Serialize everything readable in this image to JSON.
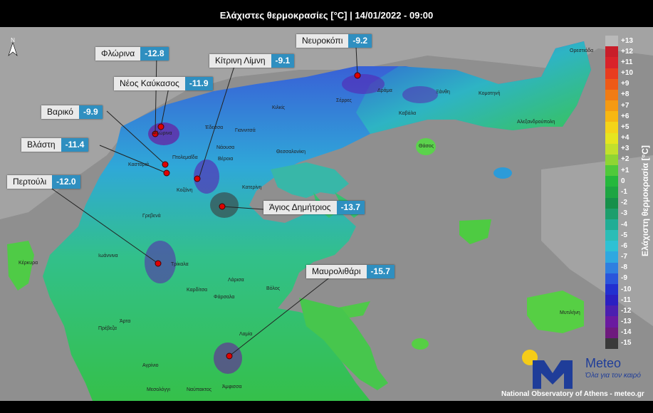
{
  "title": "Ελάχιστες θερμοκρασίες [°C] | 14/01/2022 - 09:00",
  "north_arrow": {
    "icon": "north-arrow-icon",
    "letter": "N"
  },
  "legend": {
    "title": "Ελάχιστη θερμοκρασία [°C]",
    "levels": [
      {
        "value": "+13",
        "color": "#b9b9b9"
      },
      {
        "value": "+12",
        "color": "#c81e2a"
      },
      {
        "value": "+11",
        "color": "#d9232a"
      },
      {
        "value": "+10",
        "color": "#e83c1f"
      },
      {
        "value": "+9",
        "color": "#ee5a17"
      },
      {
        "value": "+8",
        "color": "#f07c14"
      },
      {
        "value": "+7",
        "color": "#f59a12"
      },
      {
        "value": "+6",
        "color": "#f8b712"
      },
      {
        "value": "+5",
        "color": "#f5d418"
      },
      {
        "value": "+4",
        "color": "#e6e51f"
      },
      {
        "value": "+3",
        "color": "#c2e02c"
      },
      {
        "value": "+2",
        "color": "#8fd533"
      },
      {
        "value": "+1",
        "color": "#4fc93a"
      },
      {
        "value": "0",
        "color": "#25b83c"
      },
      {
        "value": "-1",
        "color": "#1da542"
      },
      {
        "value": "-2",
        "color": "#16904a"
      },
      {
        "value": "-3",
        "color": "#1d9e6c"
      },
      {
        "value": "-4",
        "color": "#21ad95"
      },
      {
        "value": "-5",
        "color": "#2bbdb6"
      },
      {
        "value": "-6",
        "color": "#2ec1d4"
      },
      {
        "value": "-7",
        "color": "#2fa8e0"
      },
      {
        "value": "-8",
        "color": "#2f7fe0"
      },
      {
        "value": "-9",
        "color": "#2a55db"
      },
      {
        "value": "-10",
        "color": "#2230d0"
      },
      {
        "value": "-11",
        "color": "#2b1fc1"
      },
      {
        "value": "-12",
        "color": "#4b1fb0"
      },
      {
        "value": "-13",
        "color": "#6a1aa0"
      },
      {
        "value": "-14",
        "color": "#6e1a7e"
      },
      {
        "value": "-15",
        "color": "#3a3a3a"
      }
    ]
  },
  "stations": [
    {
      "name": "Φλώρινα",
      "value": "-12.8"
    },
    {
      "name": "Νέος Καύκασος",
      "value": "-11.9"
    },
    {
      "name": "Βαρικό",
      "value": "-9.9"
    },
    {
      "name": "Βλάστη",
      "value": "-11.4"
    },
    {
      "name": "Περτούλι",
      "value": "-12.0"
    },
    {
      "name": "Κίτρινη Λίμνη",
      "value": "-9.1"
    },
    {
      "name": "Νευροκόπι",
      "value": "-9.2"
    },
    {
      "name": "Άγιος Δημήτριος",
      "value": "-13.7"
    },
    {
      "name": "Μαυρολιθάρι",
      "value": "-15.7"
    }
  ],
  "towns": [
    "Φλώρινα",
    "Έδεσσα",
    "Γιαννιτσά",
    "Κιλκίς",
    "Σέρρες",
    "Δράμα",
    "Ξάνθη",
    "Κομοτηνή",
    "Ορεστιάδα",
    "Αλεξανδρούπολη",
    "Καβάλα",
    "Θάσος",
    "Θεσσαλονίκη",
    "Νάουσα",
    "Βέροια",
    "Κατερίνη",
    "Πτολεμαΐδα",
    "Καστοριά",
    "Κοζάνη",
    "Γρεβενά",
    "Ιωάννινα",
    "Κέρκυρα",
    "Τρίκαλα",
    "Λάρισα",
    "Καρδίτσα",
    "Βόλος",
    "Φάρσαλα",
    "Λαμία",
    "Αγρίνιο",
    "Μεσολόγγι",
    "Ναύπακτος",
    "Άμφισσα",
    "Άρτα",
    "Πρέβεζα",
    "Μυτιλήνη"
  ],
  "logo": {
    "icon": "meteo-logo-icon",
    "wordmark": "Meteo",
    "tagline": "Όλα για τον καιρό"
  },
  "credit": "National Observatory of Athens - meteo.gr",
  "colors": {
    "sea": "#8f8f8f",
    "land_outside": "#9d9d9d",
    "label_bg": "#e9e9e9",
    "value_bg": "#2f8fc0",
    "marker": "#e00000"
  }
}
